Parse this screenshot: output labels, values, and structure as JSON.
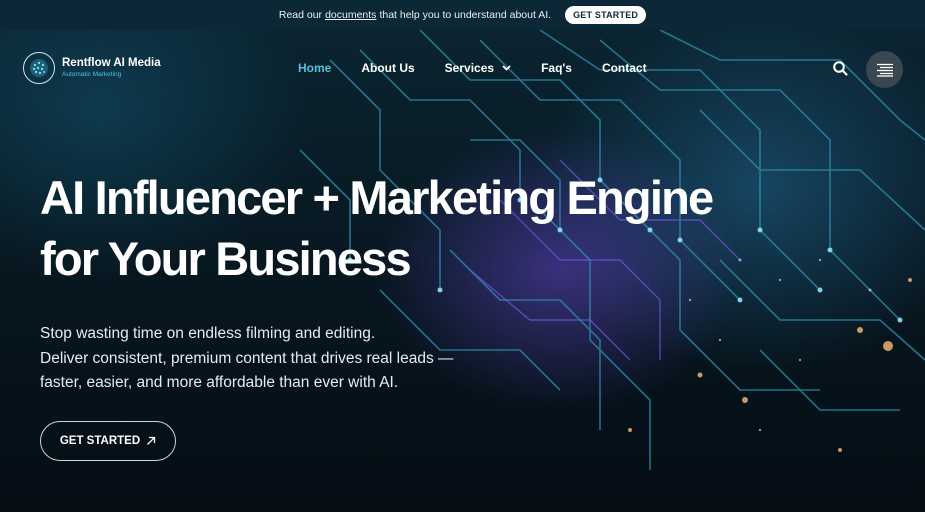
{
  "topbar": {
    "prefix": "Read our",
    "link_text": "documents",
    "suffix": "that help you to understand about AI.",
    "button_label": "GET STARTED"
  },
  "brand": {
    "name": "Rentflow AI Media",
    "tagline": "Automatic Marketing"
  },
  "nav": {
    "items": [
      {
        "label": "Home",
        "active": true
      },
      {
        "label": "About Us"
      },
      {
        "label": "Services",
        "has_dropdown": true
      },
      {
        "label": "Faq's"
      },
      {
        "label": "Contact"
      }
    ],
    "search_icon": "search-icon",
    "menu_icon": "hamburger-menu-icon"
  },
  "hero": {
    "headline_line1": "AI Influencer + Marketing Engine",
    "headline_line2": "for Your Business",
    "sub_line1": "Stop wasting time on endless filming and editing.",
    "sub_line2": "Deliver consistent, premium content that drives real leads —",
    "sub_line3": "faster, easier, and more affordable than ever with AI.",
    "cta_label": "GET STARTED",
    "cta_icon": "arrow-up-right-icon"
  },
  "colors": {
    "topbar_bg": "#0c2836",
    "accent": "#52c3df",
    "background": "#06141c"
  }
}
